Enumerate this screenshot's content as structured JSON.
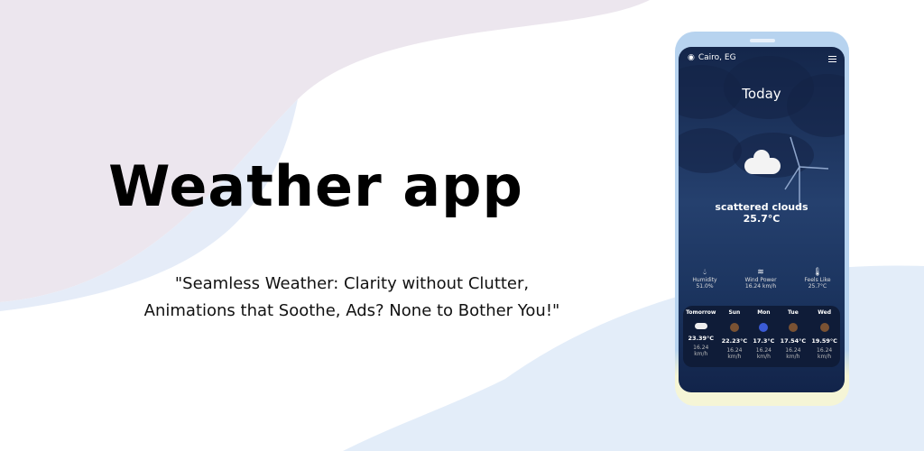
{
  "headline": "Weather app",
  "tagline": [
    "\"Seamless Weather: Clarity without Clutter,",
    "Animations that Soothe, Ads? None to Bother You!\""
  ],
  "app": {
    "location": "Cairo, EG",
    "heading": "Today",
    "condition": "scattered clouds",
    "temperature": "25.7°C",
    "stats": [
      {
        "icon": "droplet-icon",
        "label": "Humidity",
        "value": "51.0%"
      },
      {
        "icon": "wind-icon",
        "label": "Wind Power",
        "value": "16.24 km/h"
      },
      {
        "icon": "thermometer-icon",
        "label": "Feels Like",
        "value": "25.7°C"
      }
    ],
    "forecast": [
      {
        "day": "Tomorrow",
        "icon": "cloud-icon",
        "temp": "23.39°C",
        "wind": "16.24",
        "unit": "km/h"
      },
      {
        "day": "Sun",
        "icon": "moon-icon",
        "temp": "22.23°C",
        "wind": "16.24",
        "unit": "km/h"
      },
      {
        "day": "Mon",
        "icon": "rain-cloud-icon",
        "temp": "17.3°C",
        "wind": "16.24",
        "unit": "km/h"
      },
      {
        "day": "Tue",
        "icon": "moon-icon",
        "temp": "17.54°C",
        "wind": "16.24",
        "unit": "km/h"
      },
      {
        "day": "Wed",
        "icon": "moon-icon",
        "temp": "19.59°C",
        "wind": "16.24",
        "unit": "km/h"
      }
    ]
  }
}
